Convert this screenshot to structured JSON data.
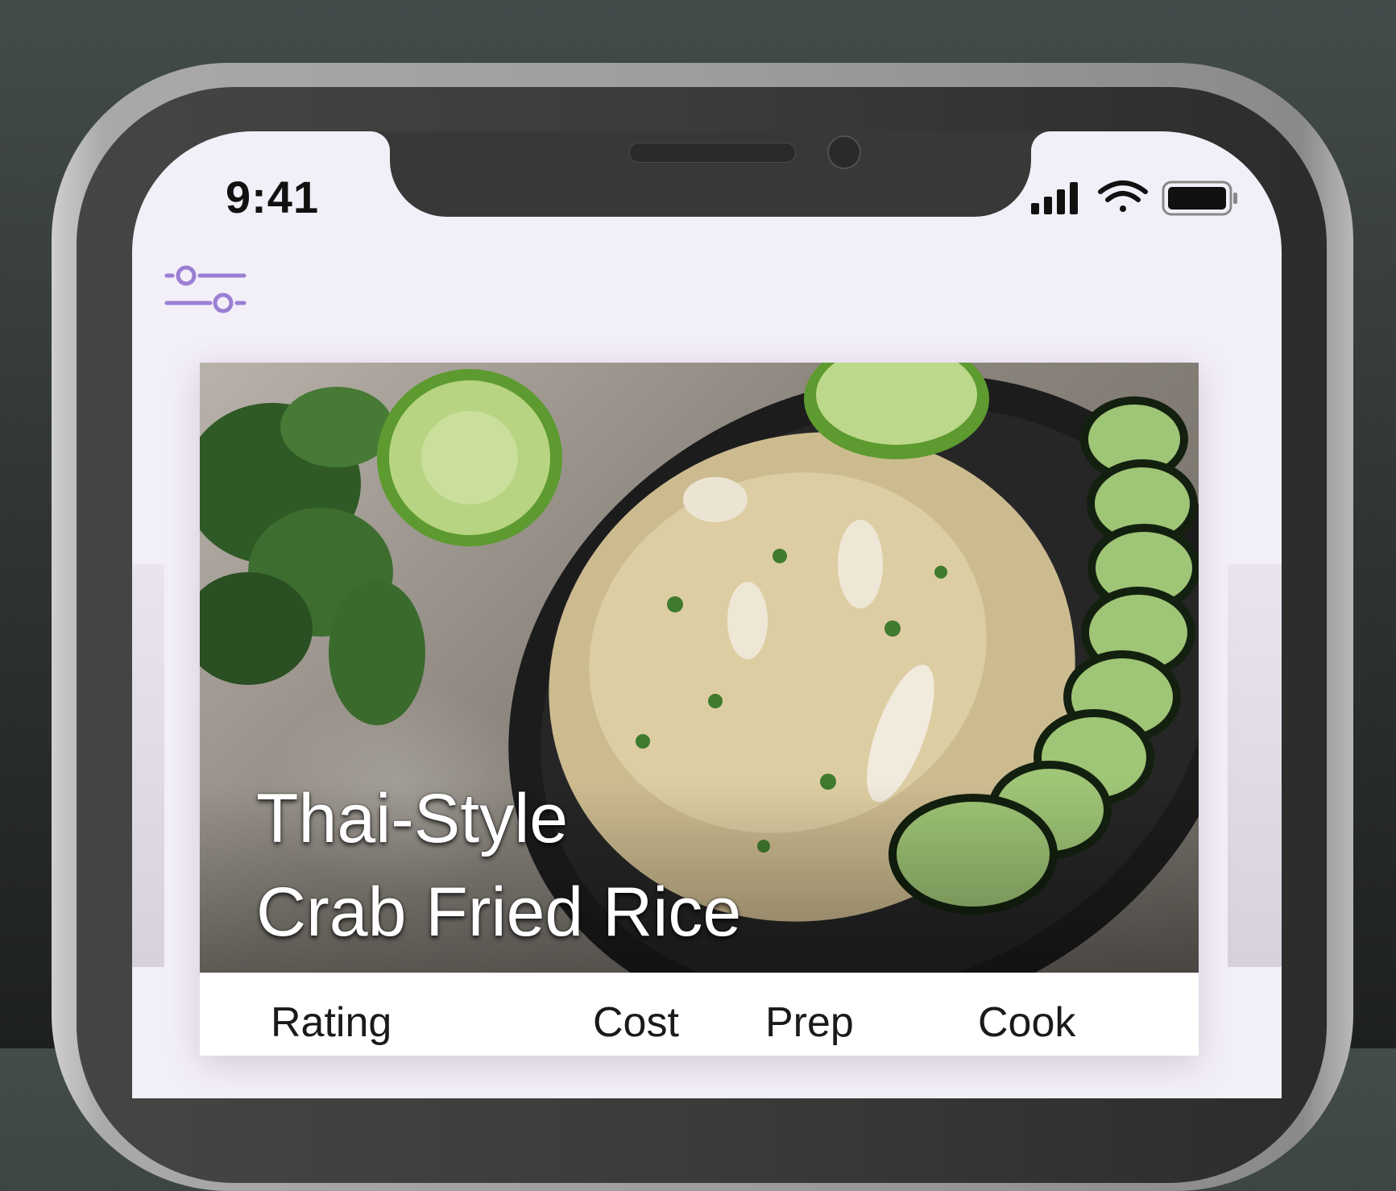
{
  "status_bar": {
    "time": "9:41",
    "icons": [
      "signal-bars-icon",
      "wifi-icon",
      "battery-icon"
    ]
  },
  "toolbar": {
    "filter_icon": "sliders-filter-icon",
    "accent_color": "#9b7fd4"
  },
  "recipe_card": {
    "title_line1": "Thai-Style",
    "title_line2": "Crab Fried Rice",
    "image": "crab-fried-rice-photo",
    "stat_labels": [
      "Rating",
      "Cost",
      "Prep",
      "Cook"
    ]
  },
  "colors": {
    "screen_background": "#f3eff8",
    "card_background": "#ffffff",
    "title_text": "#ffffff"
  }
}
